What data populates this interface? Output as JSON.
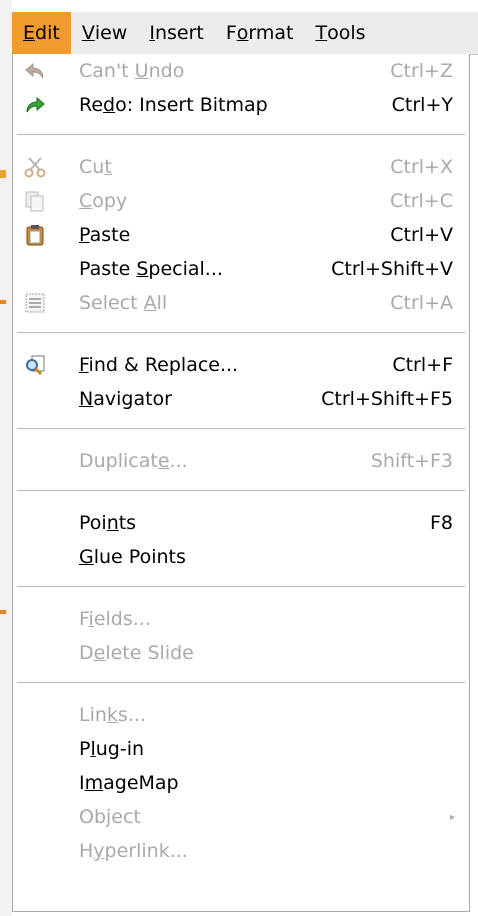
{
  "menubar": {
    "items": [
      {
        "label": "Edit",
        "mnemonic_index": 0
      },
      {
        "label": "View",
        "mnemonic_index": 0
      },
      {
        "label": "Insert",
        "mnemonic_index": 0
      },
      {
        "label": "Format",
        "mnemonic_index": 1
      },
      {
        "label": "Tools",
        "mnemonic_index": 0
      }
    ]
  },
  "menu": {
    "items": [
      {
        "pre": "Can't ",
        "mn": "U",
        "post": "ndo",
        "shortcut": "Ctrl+Z",
        "enabled": false,
        "icon": "undo-icon"
      },
      {
        "pre": "Re",
        "mn": "d",
        "post": "o: Insert Bitmap",
        "shortcut": "Ctrl+Y",
        "enabled": true,
        "icon": "redo-icon"
      },
      {
        "pre": "Cu",
        "mn": "t",
        "post": "",
        "shortcut": "Ctrl+X",
        "enabled": false,
        "icon": "cut-icon"
      },
      {
        "pre": "",
        "mn": "C",
        "post": "opy",
        "shortcut": "Ctrl+C",
        "enabled": false,
        "icon": "copy-icon"
      },
      {
        "pre": "",
        "mn": "P",
        "post": "aste",
        "shortcut": "Ctrl+V",
        "enabled": true,
        "icon": "paste-icon"
      },
      {
        "pre": "Paste ",
        "mn": "S",
        "post": "pecial...",
        "shortcut": "Ctrl+Shift+V",
        "enabled": true,
        "icon": ""
      },
      {
        "pre": "Select ",
        "mn": "A",
        "post": "ll",
        "shortcut": "Ctrl+A",
        "enabled": false,
        "icon": "select-all-icon"
      },
      {
        "pre": "",
        "mn": "F",
        "post": "ind & Replace...",
        "shortcut": "Ctrl+F",
        "enabled": true,
        "icon": "find-replace-icon"
      },
      {
        "pre": "",
        "mn": "N",
        "post": "avigator",
        "shortcut": "Ctrl+Shift+F5",
        "enabled": true,
        "icon": ""
      },
      {
        "pre": "Duplicat",
        "mn": "e",
        "post": "...",
        "shortcut": "Shift+F3",
        "enabled": false,
        "icon": ""
      },
      {
        "pre": "Poi",
        "mn": "n",
        "post": "ts",
        "shortcut": "F8",
        "enabled": true,
        "icon": ""
      },
      {
        "pre": "",
        "mn": "G",
        "post": "lue Points",
        "shortcut": "",
        "enabled": true,
        "icon": ""
      },
      {
        "pre": "F",
        "mn": "i",
        "post": "elds...",
        "shortcut": "",
        "enabled": false,
        "icon": ""
      },
      {
        "pre": "D",
        "mn": "e",
        "post": "lete Slide",
        "shortcut": "",
        "enabled": false,
        "icon": ""
      },
      {
        "pre": "Lin",
        "mn": "k",
        "post": "s...",
        "shortcut": "",
        "enabled": false,
        "icon": ""
      },
      {
        "pre": "P",
        "mn": "l",
        "post": "ug-in",
        "shortcut": "",
        "enabled": true,
        "icon": ""
      },
      {
        "pre": "I",
        "mn": "m",
        "post": "ageMap",
        "shortcut": "",
        "enabled": true,
        "icon": ""
      },
      {
        "pre": "Ob",
        "mn": "j",
        "post": "ect",
        "shortcut": "",
        "enabled": false,
        "icon": "",
        "submenu": true
      },
      {
        "pre": "H",
        "mn": "y",
        "post": "perlink...",
        "shortcut": "",
        "enabled": false,
        "icon": ""
      }
    ]
  },
  "colors": {
    "active_menu_bg": "#ef9b2d",
    "disabled_text": "#a9a9a9",
    "separator": "#b9b9b9"
  }
}
